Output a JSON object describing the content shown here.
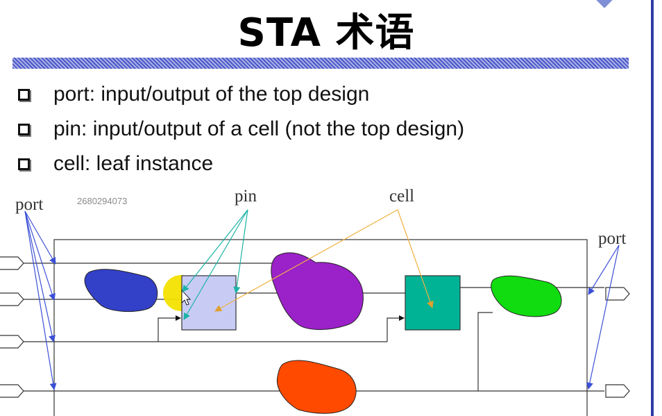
{
  "slide": {
    "title": "STA 术语",
    "bullets": [
      {
        "text": "port: input/output of the top design"
      },
      {
        "text": "pin: input/output of a cell (not the top design)"
      },
      {
        "text": "cell: leaf instance"
      }
    ],
    "watermark": "2680294073"
  },
  "diagram": {
    "labels": {
      "port_left": "port",
      "pin": "pin",
      "cell": "cell",
      "port_right": "port"
    },
    "colors": {
      "blue_blob": "#3340c8",
      "purple_blob": "#9b21c9",
      "orange_blob": "#ff4a00",
      "green_blob": "#10dc10",
      "pin_cell": "#c8ccf5",
      "teal_cell": "#00b395",
      "highlight": "#f3e100",
      "port_arrow": "#3b4fd6",
      "pin_arrow": "#1bb3a6",
      "cell_arrow": "#f0b040"
    }
  }
}
